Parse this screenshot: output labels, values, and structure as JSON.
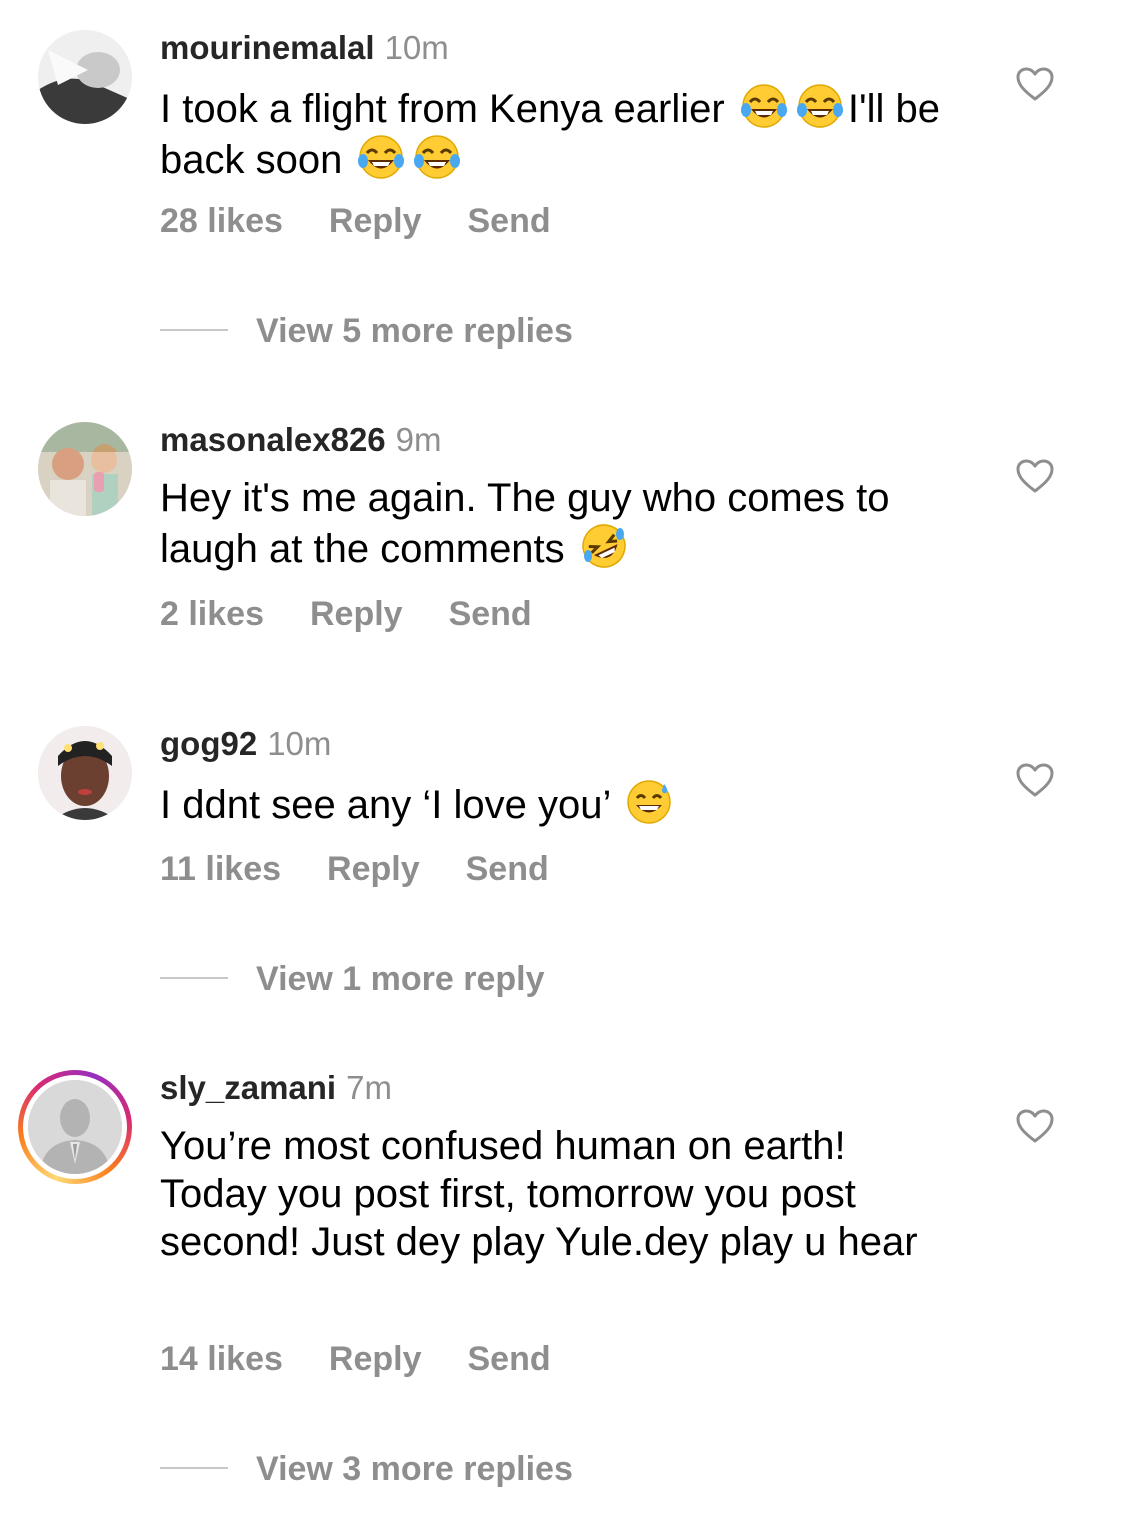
{
  "comments": [
    {
      "username": "mourinemalal",
      "time": "10m",
      "text_parts": [
        "I took a flight from Kenya earlier ",
        "I'll be back soon "
      ],
      "emojis": [
        "face-with-tears-of-joy",
        "face-with-tears-of-joy",
        "face-with-tears-of-joy",
        "face-with-tears-of-joy"
      ],
      "likes": "28 likes",
      "reply": "Reply",
      "send": "Send",
      "view_more": "View 5 more replies"
    },
    {
      "username": "masonalex826",
      "time": "9m",
      "text_parts": [
        "Hey it's me again. The guy who comes to laugh at the comments "
      ],
      "emojis": [
        "rolling-on-floor-laughing"
      ],
      "likes": "2 likes",
      "reply": "Reply",
      "send": "Send"
    },
    {
      "username": "gog92",
      "time": "10m",
      "text_parts": [
        "I ddnt see any ‘I love you’ "
      ],
      "emojis": [
        "grinning-face-with-sweat"
      ],
      "likes": "11 likes",
      "reply": "Reply",
      "send": "Send",
      "view_more": "View 1 more reply"
    },
    {
      "username": "sly_zamani",
      "time": "7m",
      "text": "You’re most confused human on earth! Today you post first, tomorrow you post second! Just dey play Yule.dey play u hear",
      "likes": "14 likes",
      "reply": "Reply",
      "send": "Send",
      "view_more": "View 3 more replies"
    }
  ],
  "icons": {
    "like": "heart-outline-icon"
  },
  "colors": {
    "secondary_text": "#8e8e8e",
    "story_ring": [
      "#feda75",
      "#fa7e1e",
      "#d62976",
      "#962fbf"
    ]
  }
}
